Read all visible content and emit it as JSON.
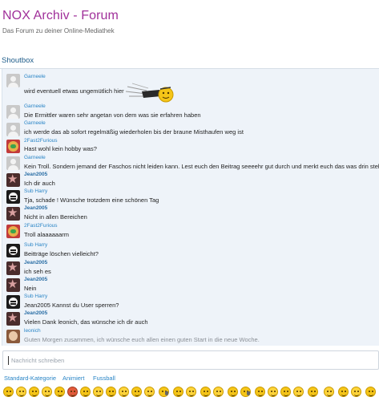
{
  "header": {
    "title": "NOX Archiv - Forum",
    "subtitle": "Das Forum zu deiner Online-Mediathek"
  },
  "shoutbox": {
    "title": "Shoutbox",
    "messages": [
      {
        "author": "Garneele",
        "text": "wird eventuell etwas ungemütlich hier",
        "avatar": "default-avatar"
      },
      {
        "author": "Garneele",
        "text": "Die Ermittler waren sehr angetan von dem was sie erfahren haben",
        "avatar": "default-avatar"
      },
      {
        "author": "Garneele",
        "text": "ich werde das ab sofort regelmäßig wiederholen bis der braune Misthaufen weg ist",
        "avatar": "default-avatar"
      },
      {
        "author": "2Fast2Furious",
        "text": "Hast wohl kein hobby was?",
        "avatar": "mickey-avatar"
      },
      {
        "author": "Garneele",
        "text": "Kein Troll. Sondern jemand der Faschos nicht leiden kann. Lest euch den Beitrag seeeehr gut durch und merkt euch das was drin steht",
        "avatar": "default-avatar"
      },
      {
        "author": "Jean2005",
        "text": "Ich dir auch",
        "avatar": "star-avatar"
      },
      {
        "author": "Sub Harry",
        "text": "Tja, schade ! Wünsche trotzdem eine schönen Tag",
        "avatar": "face-avatar"
      },
      {
        "author": "Jean2005",
        "text": "Nicht in allen Bereichen",
        "avatar": "star-avatar"
      },
      {
        "author": "2Fast2Furious",
        "text": "Troll alaaaaaarm",
        "avatar": "mickey-avatar"
      },
      {
        "author": "Sub Harry",
        "text": "Beitträge löschen vielleicht?",
        "avatar": "face-avatar"
      },
      {
        "author": "Jean2005",
        "text": "ich seh es",
        "avatar": "star-avatar"
      },
      {
        "author": "Jean2005",
        "text": "Nein",
        "avatar": "star-avatar"
      },
      {
        "author": "Sub Harry",
        "text": "Jean2005 Kannst du User sperren?",
        "avatar": "face-avatar"
      },
      {
        "author": "Jean2005",
        "text": "Vielen Dank leonich, das wünsche ich dir auch",
        "avatar": "star-avatar"
      },
      {
        "author": "leonich",
        "text": "Guten Morgen zusammen, ich wünsche euch allen einen guten Start in die neue Woche.",
        "avatar": "leonich-avatar"
      }
    ],
    "input_placeholder": "Nachricht schreiben"
  },
  "smiley_tabs": [
    "Standard-Kategorie",
    "Animiert",
    "Fussball"
  ],
  "smileys": [
    "smiley-icon",
    "smiley-icon",
    "smiley-icon",
    "smiley-icon",
    "smiley-icon",
    "smiley-icon",
    "smiley-icon",
    "smiley-icon",
    "smiley-icon",
    "smiley-icon",
    "smiley-icon",
    "smiley-icon",
    "smiley-icon",
    "smiley-icon",
    "smiley-icon",
    "smiley-icon",
    "smiley-icon",
    "smiley-icon",
    "smiley-icon",
    "smiley-icon",
    "smiley-icon",
    "smiley-icon",
    "smiley-icon",
    "smiley-icon",
    "smiley-icon",
    "smiley-icon",
    "smiley-icon",
    "smiley-icon",
    "smiley-icon",
    "smiley-icon"
  ],
  "colors": {
    "title": "#a0309a",
    "accent": "#2a85c6",
    "shoutbox_bg": "#eef3f9"
  }
}
